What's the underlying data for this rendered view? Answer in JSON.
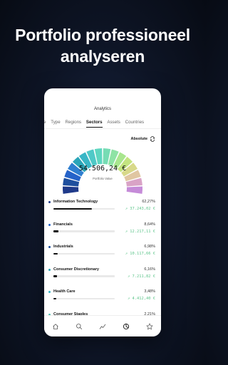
{
  "headline": {
    "line1": "Portfolio professioneel",
    "line2": "analyseren"
  },
  "screen": {
    "title": "Analytics",
    "tabs": [
      "ve",
      "Type",
      "Regions",
      "Sectors",
      "Assets",
      "Countries"
    ],
    "active_tab": "Sectors",
    "toggle_label": "Absolute",
    "portfolio_value": "54.506,24 €",
    "portfolio_label": "Portfolio Value"
  },
  "sectors": [
    {
      "name": "Information Technology",
      "pct": "62,27%",
      "share": 0.6227,
      "change": "↗ 37.243,02 €",
      "dot": "#1f3a8a"
    },
    {
      "name": "Financials",
      "pct": "8,64%",
      "share": 0.0864,
      "change": "↗ 12.217,11 €",
      "dot": "#2563c9"
    },
    {
      "name": "Industrials",
      "pct": "6,98%",
      "share": 0.0698,
      "change": "↗ 10.117,66 €",
      "dot": "#1e4f9e"
    },
    {
      "name": "Consumer Discretionary",
      "pct": "6,16%",
      "share": 0.0616,
      "change": "↗ 7.211,82 €",
      "dot": "#2aa5b8"
    },
    {
      "name": "Health Care",
      "pct": "3,48%",
      "share": 0.0348,
      "change": "↗ 4.412,40 €",
      "dot": "#38b6c6"
    },
    {
      "name": "Consumer Staples",
      "pct": "2,21%",
      "share": 0.0221,
      "change": "",
      "dot": "#4fc0b0"
    }
  ],
  "gauge_colors": [
    "#1f3a8a",
    "#1e4f9e",
    "#2563c9",
    "#2f7fd0",
    "#2aa5b8",
    "#38b6c6",
    "#4fc9c7",
    "#5ed6c0",
    "#76dcb4",
    "#8ee3a5",
    "#a8e68e",
    "#c3e480",
    "#d8d98a",
    "#e0c6a2",
    "#d9a3c6",
    "#c58bd8"
  ],
  "nav_icons": [
    "home-icon",
    "search-icon",
    "chart-icon",
    "analytics-icon",
    "star-icon"
  ]
}
